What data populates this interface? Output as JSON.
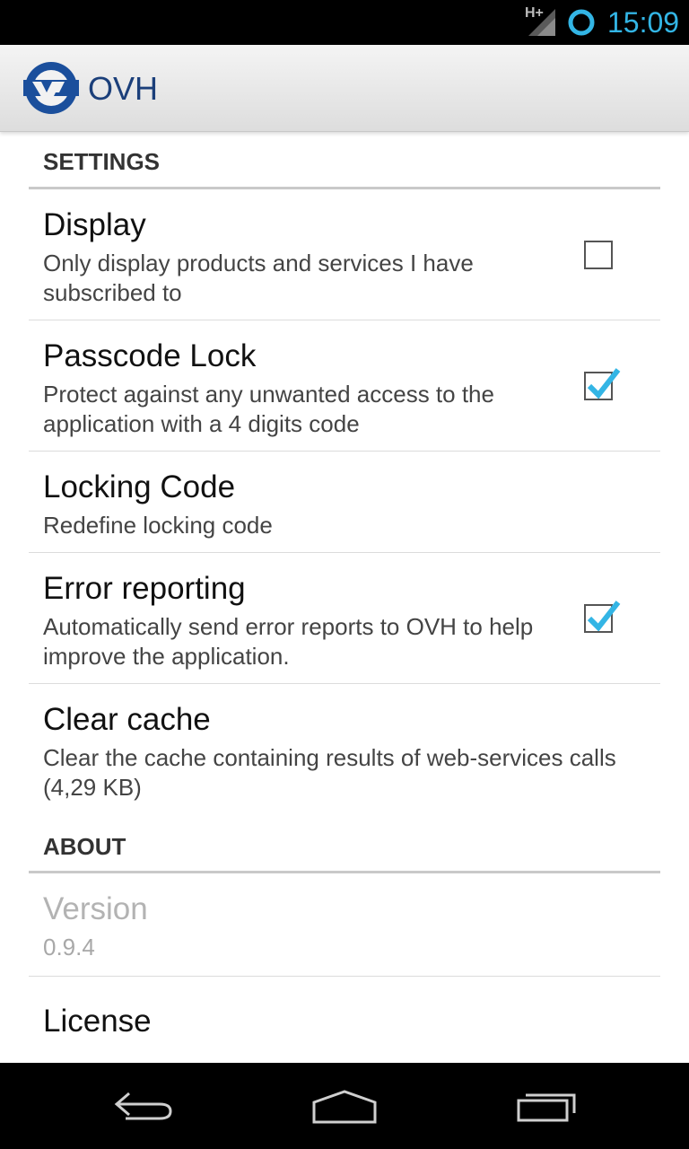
{
  "status_bar": {
    "network_type": "H+",
    "time": "15:09"
  },
  "action_bar": {
    "title": "OVH",
    "logo_icon": "ovh-logo-icon"
  },
  "settings_section": {
    "header": "SETTINGS",
    "items": [
      {
        "title": "Display",
        "summary": "Only display products and services I have subscribed to",
        "checkbox": true,
        "checked": false
      },
      {
        "title": "Passcode Lock",
        "summary": "Protect against any unwanted access to the application with a 4 digits code",
        "checkbox": true,
        "checked": true
      },
      {
        "title": "Locking Code",
        "summary": "Redefine locking code",
        "checkbox": false
      },
      {
        "title": "Error reporting",
        "summary": "Automatically send error reports to OVH to help improve the application.",
        "checkbox": true,
        "checked": true
      },
      {
        "title": "Clear cache",
        "summary": "Clear the cache containing results of web-services calls (4,29 KB)",
        "checkbox": false
      }
    ]
  },
  "about_section": {
    "header": "ABOUT",
    "items": [
      {
        "title": "Version",
        "summary": "0.9.4",
        "enabled": false
      },
      {
        "title": "License",
        "summary": "",
        "enabled": true
      }
    ]
  },
  "nav_bar": {
    "buttons": [
      "back-icon",
      "home-icon",
      "recent-apps-icon"
    ]
  },
  "colors": {
    "accent": "#33b5e5",
    "brand": "#1b3f7a"
  }
}
